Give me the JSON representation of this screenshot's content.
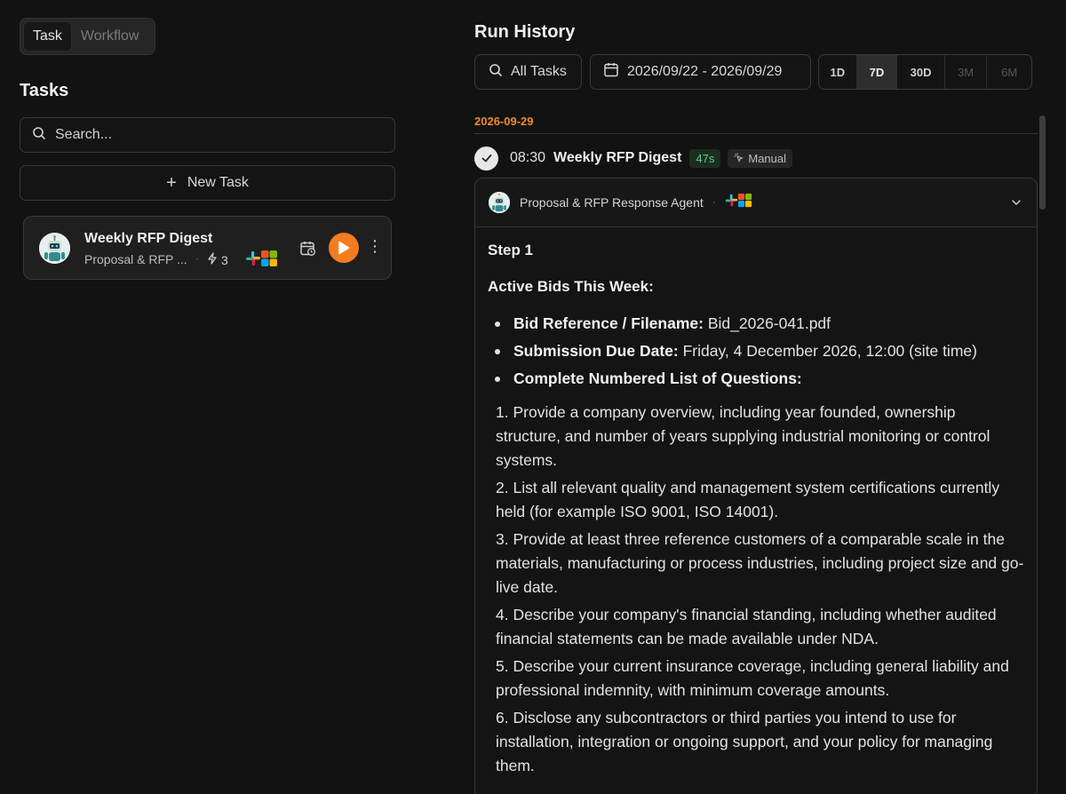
{
  "mode_switch": {
    "options": [
      "Task",
      "Workflow"
    ],
    "active": "Task"
  },
  "tasks_panel": {
    "title": "Tasks",
    "search_placeholder": "Search...",
    "new_task_label": "New Task",
    "task_card": {
      "title": "Weekly RFP Digest",
      "subtitle": "Proposal & RFP ...",
      "trigger_count": "3",
      "apps": [
        "slack-icon",
        "microsoft-icon"
      ]
    }
  },
  "run_history": {
    "title": "Run History",
    "task_filter": "All Tasks",
    "date_range": "2026/09/22 - 2026/09/29",
    "ranges": [
      "1D",
      "7D",
      "30D",
      "3M",
      "6M"
    ],
    "active_range": "7D",
    "disabled_ranges": [
      "3M",
      "6M"
    ],
    "groups": [
      {
        "date": "2026-09-29",
        "runs": [
          {
            "time": "08:30",
            "name": "Weekly RFP Digest",
            "duration": "47s",
            "trigger": "Manual",
            "status": "success",
            "agent": "Proposal & RFP Response Agent",
            "step_label": "Step 1",
            "section_title": "Active Bids This Week:",
            "bullets": [
              {
                "label": "Bid Reference / Filename:",
                "value": "Bid_2026-041.pdf"
              },
              {
                "label": "Submission Due Date:",
                "value": "Friday, 4 December 2026, 12:00 (site time)"
              },
              {
                "label": "Complete Numbered List of Questions:",
                "value": ""
              }
            ],
            "questions": [
              "1. Provide a company overview, including year founded, ownership structure, and number of years supplying industrial monitoring or control systems.",
              "2. List all relevant quality and management system certifications currently held (for example ISO 9001, ISO 14001).",
              "3. Provide at least three reference customers of a comparable scale in the materials, manufacturing or process industries, including project size and go-live date.",
              "4. Describe your company's financial standing, including whether audited financial statements can be made available under NDA.",
              "5. Describe your current insurance coverage, including general liability and professional indemnity, with minimum coverage amounts.",
              "6. Disclose any subcontractors or third parties you intend to use for installation, integration or ongoing support, and your policy for managing them."
            ]
          }
        ]
      }
    ]
  },
  "colors": {
    "accent": "#f47c20",
    "date_heading": "#f08a2c",
    "duration_text": "#67c98b",
    "background": "#121212"
  }
}
